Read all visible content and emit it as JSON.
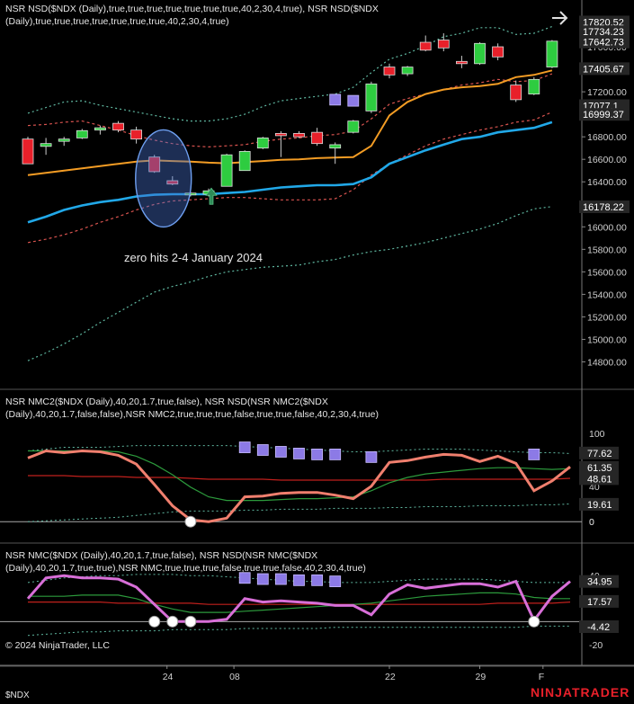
{
  "colors": {
    "background": "#000000",
    "up_candle": "#2ecc40",
    "down_candle": "#e8202a",
    "orange_band": "#f39c24",
    "cyan_band": "#21a8e8",
    "outer_band": "#5fb7a0",
    "red_dotted": "#d9534f",
    "salmon": "#f07f6e",
    "magenta": "#d86fd8",
    "dark_green": "#2c9a3c",
    "dark_red": "#c0201c",
    "marker": "#8c7ae6",
    "brand": "#e8202a",
    "label_box": "#262626"
  },
  "chart_data": [
    {
      "type": "candlestick",
      "title": "NSR NSD($NDX (Daily),true,true,true,true,true,true,true,40,2,30,4,true), NSR NSD($NDX (Daily),true,true,true,true,true,true,true,40,2,30,4,true)",
      "title_line1": "NSR NSD($NDX (Daily),true,true,true,true,true,true,true,40,2,30,4,true), NSR NSD($NDX",
      "title_line2": "(Daily),true,true,true,true,true,true,true,40,2,30,4,true)",
      "y_ticks": [
        14800,
        15000,
        15200,
        15400,
        15600,
        15800,
        16000,
        16200,
        16400,
        16600,
        16800,
        17000,
        17200,
        17400,
        17600
      ],
      "ylim": [
        14660,
        17840
      ],
      "price_labels": [
        "17820.52",
        "17734.23",
        "17642.73",
        "17405.67",
        "17077.1",
        "16999.37",
        "16178.22"
      ],
      "candles": [
        {
          "o": 16780,
          "h": 16800,
          "l": 16560,
          "c": 16560
        },
        {
          "o": 16715,
          "h": 16790,
          "l": 16640,
          "c": 16740
        },
        {
          "o": 16760,
          "h": 16800,
          "l": 16720,
          "c": 16780
        },
        {
          "o": 16790,
          "h": 16870,
          "l": 16780,
          "c": 16855
        },
        {
          "o": 16860,
          "h": 16900,
          "l": 16820,
          "c": 16880
        },
        {
          "o": 16920,
          "h": 16940,
          "l": 16840,
          "c": 16860
        },
        {
          "o": 16860,
          "h": 16890,
          "l": 16740,
          "c": 16780
        },
        {
          "o": 16620,
          "h": 16640,
          "l": 16480,
          "c": 16490
        },
        {
          "o": 16410,
          "h": 16450,
          "l": 16370,
          "c": 16380
        },
        {
          "o": 16290,
          "h": 16310,
          "l": 16270,
          "c": 16300
        },
        {
          "o": 16290,
          "h": 16340,
          "l": 16270,
          "c": 16320
        },
        {
          "o": 16360,
          "h": 16650,
          "l": 16360,
          "c": 16640
        },
        {
          "o": 16500,
          "h": 16680,
          "l": 16500,
          "c": 16670
        },
        {
          "o": 16700,
          "h": 16800,
          "l": 16690,
          "c": 16790
        },
        {
          "o": 16830,
          "h": 16850,
          "l": 16620,
          "c": 16810
        },
        {
          "o": 16830,
          "h": 16850,
          "l": 16790,
          "c": 16800
        },
        {
          "o": 16840,
          "h": 16880,
          "l": 16720,
          "c": 16740
        },
        {
          "o": 16700,
          "h": 16750,
          "l": 16560,
          "c": 16730
        },
        {
          "o": 16840,
          "h": 16950,
          "l": 16830,
          "c": 16940
        },
        {
          "o": 17030,
          "h": 17290,
          "l": 17010,
          "c": 17270
        },
        {
          "o": 17420,
          "h": 17450,
          "l": 17320,
          "c": 17350
        },
        {
          "o": 17360,
          "h": 17430,
          "l": 17340,
          "c": 17420
        },
        {
          "o": 17640,
          "h": 17700,
          "l": 17560,
          "c": 17570
        },
        {
          "o": 17660,
          "h": 17720,
          "l": 17560,
          "c": 17590
        },
        {
          "o": 17470,
          "h": 17520,
          "l": 17410,
          "c": 17450
        },
        {
          "o": 17450,
          "h": 17640,
          "l": 17440,
          "c": 17630
        },
        {
          "o": 17600,
          "h": 17630,
          "l": 17480,
          "c": 17510
        },
        {
          "o": 17260,
          "h": 17300,
          "l": 17110,
          "c": 17130
        },
        {
          "o": 17180,
          "h": 17330,
          "l": 17170,
          "c": 17310
        },
        {
          "o": 17420,
          "h": 17660,
          "l": 17410,
          "c": 17650
        }
      ],
      "orange_line": [
        16460,
        16480,
        16500,
        16520,
        16540,
        16560,
        16580,
        16590,
        16585,
        16580,
        16570,
        16565,
        16575,
        16585,
        16595,
        16600,
        16610,
        16615,
        16620,
        16720,
        16990,
        17110,
        17180,
        17220,
        17240,
        17250,
        17270,
        17330,
        17350,
        17390
      ],
      "cyan_line": [
        16040,
        16090,
        16150,
        16190,
        16220,
        16240,
        16270,
        16285,
        16290,
        16290,
        16290,
        16300,
        16310,
        16330,
        16350,
        16360,
        16370,
        16370,
        16380,
        16440,
        16560,
        16620,
        16680,
        16730,
        16780,
        16800,
        16840,
        16860,
        16880,
        16930
      ],
      "upper_outer": [
        17010,
        17060,
        17110,
        17120,
        17080,
        17050,
        17020,
        16990,
        16960,
        16940,
        16940,
        16960,
        17000,
        17070,
        17120,
        17140,
        17160,
        17180,
        17240,
        17370,
        17490,
        17540,
        17610,
        17690,
        17720,
        17770,
        17770,
        17710,
        17720,
        17780
      ],
      "upper_red": [
        16900,
        16910,
        16930,
        16940,
        16900,
        16860,
        16810,
        16770,
        16740,
        16720,
        16710,
        16720,
        16730,
        16760,
        16780,
        16790,
        16810,
        16820,
        16850,
        16960,
        17090,
        17140,
        17180,
        17220,
        17260,
        17280,
        17310,
        17290,
        17300,
        17360
      ],
      "lower_red": [
        15860,
        15890,
        15930,
        15980,
        16040,
        16090,
        16150,
        16200,
        16230,
        16240,
        16250,
        16260,
        16260,
        16250,
        16240,
        16240,
        16240,
        16250,
        16330,
        16460,
        16560,
        16640,
        16720,
        16780,
        16820,
        16860,
        16890,
        16930,
        16950,
        17020
      ],
      "lower_outer": [
        14810,
        14880,
        14960,
        15050,
        15150,
        15240,
        15330,
        15420,
        15470,
        15510,
        15560,
        15600,
        15620,
        15640,
        15650,
        15660,
        15690,
        15710,
        15750,
        15780,
        15800,
        15830,
        15860,
        15900,
        15940,
        15980,
        16030,
        16100,
        16160,
        16180
      ],
      "markers": [
        {
          "x": 17,
          "y": 17130
        },
        {
          "x": 18,
          "y": 17120
        }
      ],
      "arrow_up_index": 10,
      "ellipse_center_index": 7.5,
      "annotation": "zero hits 2-4 January 2024"
    },
    {
      "type": "line",
      "title": "NSR NMC2($NDX (Daily),40,20,1.7,true,false), NSR NSD(NSR NMC2($NDX (Daily),40,20,1.7,false,false),NSR NMC2,true,true,true,false,true,true,false,40,2,30,4,true)",
      "title_line1": "NSR NMC2($NDX (Daily),40,20,1.7,true,false), NSR NSD(NSR NMC2($NDX",
      "title_line2": "(Daily),40,20,1.7,false,false),NSR NMC2,true,true,true,false,true,true,false,40,2,30,4,true)",
      "y_ticks": [
        0,
        40,
        100
      ],
      "ylim": [
        -12,
        112
      ],
      "value_labels": [
        "77.62",
        "61.35",
        "48.61",
        "19.61",
        "0"
      ],
      "salmon": [
        72,
        80,
        78,
        80,
        79,
        75,
        65,
        42,
        18,
        2,
        0,
        4,
        28,
        29,
        32,
        33,
        33,
        30,
        26,
        40,
        67,
        69,
        73,
        76,
        75,
        68,
        74,
        66,
        35,
        46,
        62
      ],
      "upper_dotted": [
        80,
        82,
        84,
        84,
        84,
        85,
        86,
        86,
        86,
        86,
        86,
        86,
        85,
        84,
        83,
        82,
        81,
        80,
        79,
        79,
        80,
        81,
        82,
        82,
        82,
        81,
        80,
        79,
        78,
        78,
        77
      ],
      "mid_green": [
        80,
        80,
        80,
        80,
        80,
        79,
        74,
        65,
        53,
        39,
        28,
        24,
        24,
        24,
        25,
        26,
        26,
        27,
        28,
        35,
        44,
        50,
        54,
        56,
        58,
        60,
        61,
        61,
        60,
        59,
        60
      ],
      "red_flat": [
        52,
        52,
        52,
        51,
        51,
        51,
        50,
        50,
        50,
        49,
        48,
        48,
        48,
        48,
        47,
        47,
        47,
        47,
        47,
        47,
        47,
        47,
        47,
        48,
        48,
        48,
        48,
        48,
        48,
        48,
        49
      ],
      "lower_dotted": [
        0,
        1,
        2,
        3,
        4,
        5,
        7,
        9,
        11,
        12,
        12,
        12,
        13,
        13,
        14,
        14,
        14,
        15,
        15,
        15,
        16,
        16,
        17,
        17,
        17,
        18,
        18,
        18,
        19,
        19,
        20
      ],
      "dots": [
        {
          "x": 9,
          "y": 0
        }
      ],
      "markers": [
        {
          "x": 12,
          "y": 84
        },
        {
          "x": 13,
          "y": 81
        },
        {
          "x": 14,
          "y": 79
        },
        {
          "x": 15,
          "y": 77
        },
        {
          "x": 16,
          "y": 76
        },
        {
          "x": 17,
          "y": 76
        },
        {
          "x": 19,
          "y": 73
        },
        {
          "x": 28,
          "y": 76
        }
      ]
    },
    {
      "type": "line",
      "title": "NSR NMC($NDX (Daily),40,20,1.7,true,false), NSR NSD(NSR NMC($NDX (Daily),40,20,1.7,true,true),NSR NMC,true,true,true,false,true,true,false,40,2,30,4,true)",
      "title_line1": "NSR NMC($NDX (Daily),40,20,1.7,true,false), NSR NSD(NSR NMC($NDX",
      "title_line2": "(Daily),40,20,1.7,true,true),NSR NMC,true,true,true,false,true,true,false,40,2,30,4,true)",
      "y_ticks": [
        -20,
        40
      ],
      "ylim": [
        -24,
        48
      ],
      "value_labels": [
        "34.95",
        "17.57",
        "-4.42"
      ],
      "magenta": [
        20,
        38,
        40,
        38,
        38,
        37,
        30,
        15,
        0,
        0,
        0,
        2,
        20,
        17,
        18,
        17,
        16,
        14,
        14,
        6,
        24,
        32,
        29,
        31,
        33,
        33,
        30,
        35,
        1,
        22,
        35
      ],
      "upper_dotted": [
        34,
        36,
        38,
        39,
        40,
        40,
        41,
        41,
        41,
        40,
        40,
        39,
        38,
        37,
        36,
        35,
        35,
        34,
        34,
        34,
        35,
        36,
        37,
        37,
        37,
        37,
        36,
        35,
        34,
        34,
        34
      ],
      "mid_green": [
        22,
        22,
        22,
        23,
        23,
        23,
        20,
        15,
        11,
        8,
        8,
        8,
        9,
        10,
        11,
        12,
        13,
        14,
        15,
        16,
        18,
        20,
        22,
        23,
        24,
        25,
        25,
        24,
        21,
        20,
        20
      ],
      "red_flat": [
        17,
        17,
        17,
        17,
        17,
        16,
        16,
        16,
        16,
        16,
        15,
        15,
        15,
        15,
        15,
        15,
        15,
        15,
        15,
        15,
        15,
        15,
        15,
        15,
        15,
        15,
        16,
        16,
        16,
        16,
        17
      ],
      "lower_dotted": [
        -12,
        -11,
        -10,
        -9,
        -9,
        -8,
        -8,
        -8,
        -7,
        -7,
        -7,
        -7,
        -6,
        -6,
        -6,
        -6,
        -6,
        -5,
        -5,
        -5,
        -5,
        -5,
        -5,
        -5,
        -5,
        -5,
        -5,
        -5,
        -4,
        -4,
        -4
      ],
      "dots": [
        {
          "x": 7,
          "y": 0
        },
        {
          "x": 8,
          "y": 0
        },
        {
          "x": 9,
          "y": 0
        },
        {
          "x": 28,
          "y": 0
        }
      ],
      "markers": [
        {
          "x": 12,
          "y": 38
        },
        {
          "x": 13,
          "y": 37
        },
        {
          "x": 14,
          "y": 37
        },
        {
          "x": 15,
          "y": 36
        },
        {
          "x": 16,
          "y": 36
        },
        {
          "x": 17,
          "y": 35
        }
      ]
    }
  ],
  "x_axis": {
    "labels": [
      {
        "text": "24",
        "index": 7
      },
      {
        "text": "08",
        "index": 11
      },
      {
        "text": "22",
        "index": 20
      },
      {
        "text": "29",
        "index": 25
      },
      {
        "text": "F",
        "index": 28
      }
    ]
  },
  "footer": {
    "copyright": "© 2024 NinjaTrader, LLC",
    "symbol": "$NDX",
    "brand": "NINJATRADER"
  }
}
